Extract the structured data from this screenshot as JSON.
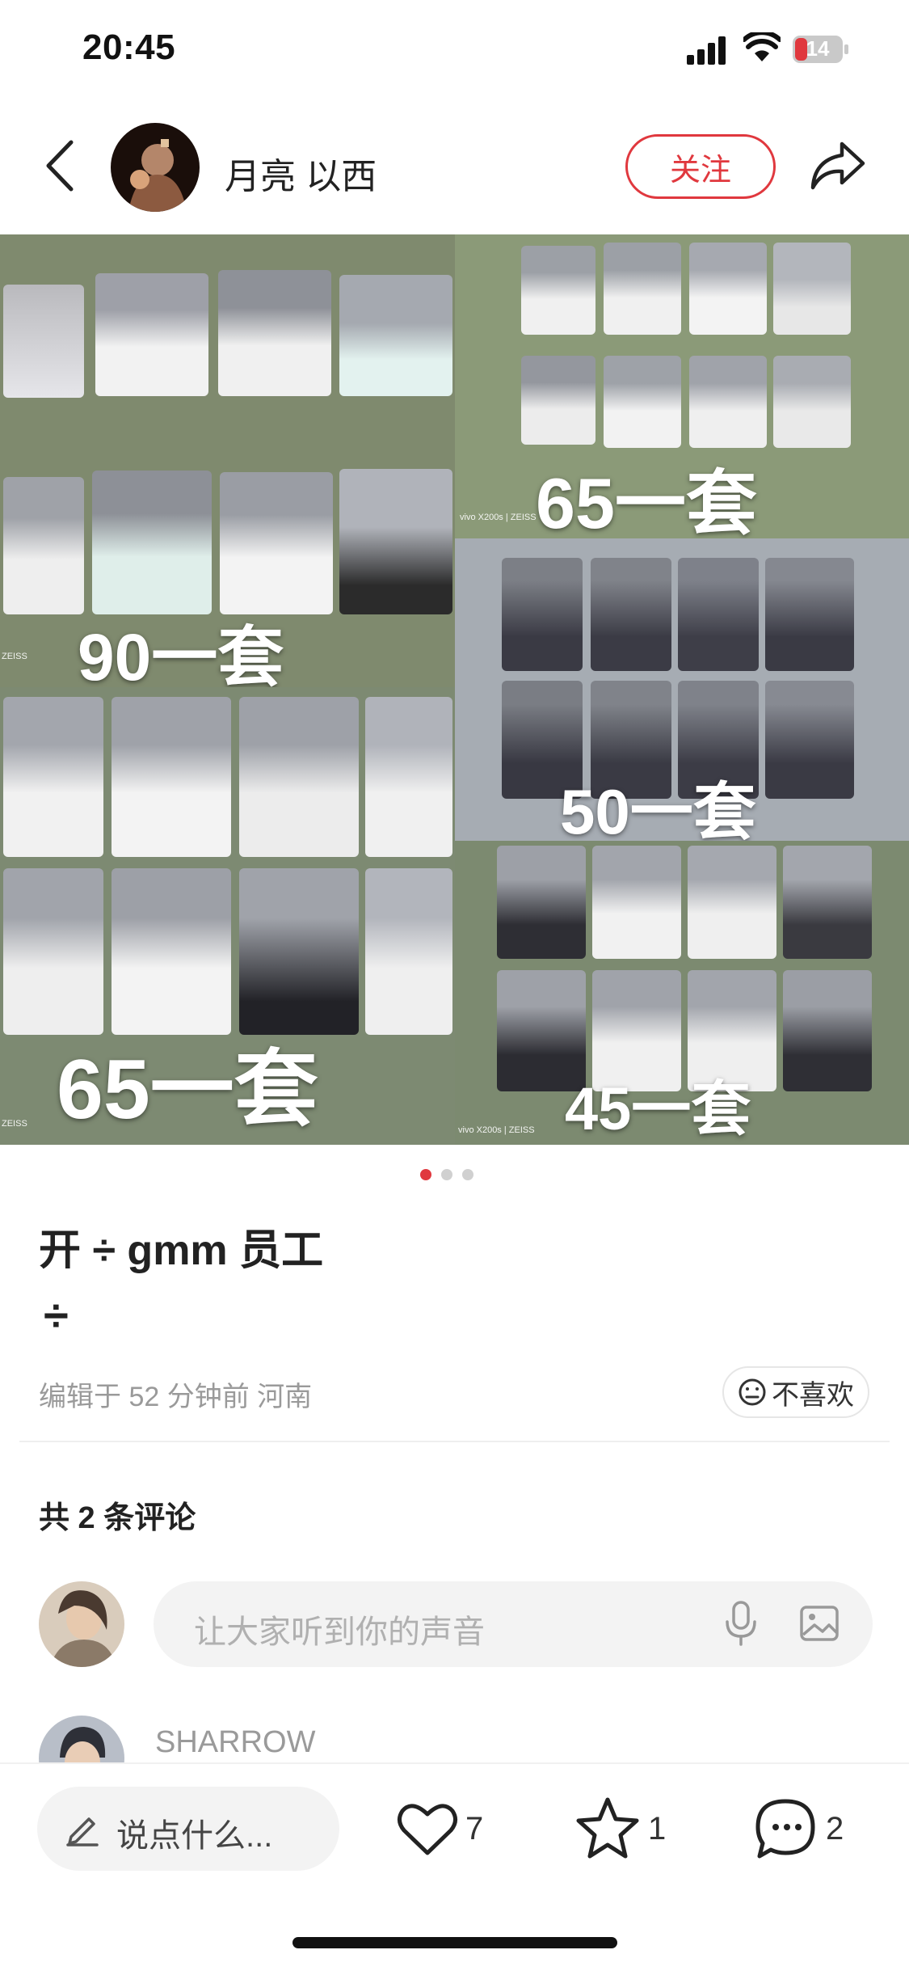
{
  "status_bar": {
    "time": "20:45",
    "battery_level": "14",
    "icons": [
      "signal-icon",
      "wifi-icon",
      "battery-icon"
    ]
  },
  "header": {
    "author_name": "月亮 以西",
    "follow_label": "关注",
    "icons": [
      "back-icon",
      "share-icon"
    ]
  },
  "collage": {
    "panels": [
      {
        "price": "90一套"
      },
      {
        "price": "65一套",
        "watermark": "vivo X200s | ZEISS"
      },
      {
        "price": "50一套"
      },
      {
        "price": "65一套"
      },
      {
        "price": "45一套",
        "watermark": "vivo X200s | ZEISS"
      }
    ],
    "watermark_zeiss": "ZEISS"
  },
  "carousel": {
    "total": 3,
    "active": 0
  },
  "post": {
    "title": "开 ÷ gmm 员工",
    "body": "÷",
    "meta": "编辑于 52 分钟前 河南",
    "dislike_label": "不喜欢"
  },
  "comments": {
    "count_label": "共 2 条评论",
    "input_placeholder": "让大家听到你的声音",
    "first_commenter": "SHARROW"
  },
  "bottom_bar": {
    "input_label": "说点什么...",
    "likes": "7",
    "stars": "1",
    "comments": "2"
  },
  "colors": {
    "accent_red": "#e0383e",
    "text_primary": "#222222",
    "text_secondary": "#9a9a9a"
  }
}
